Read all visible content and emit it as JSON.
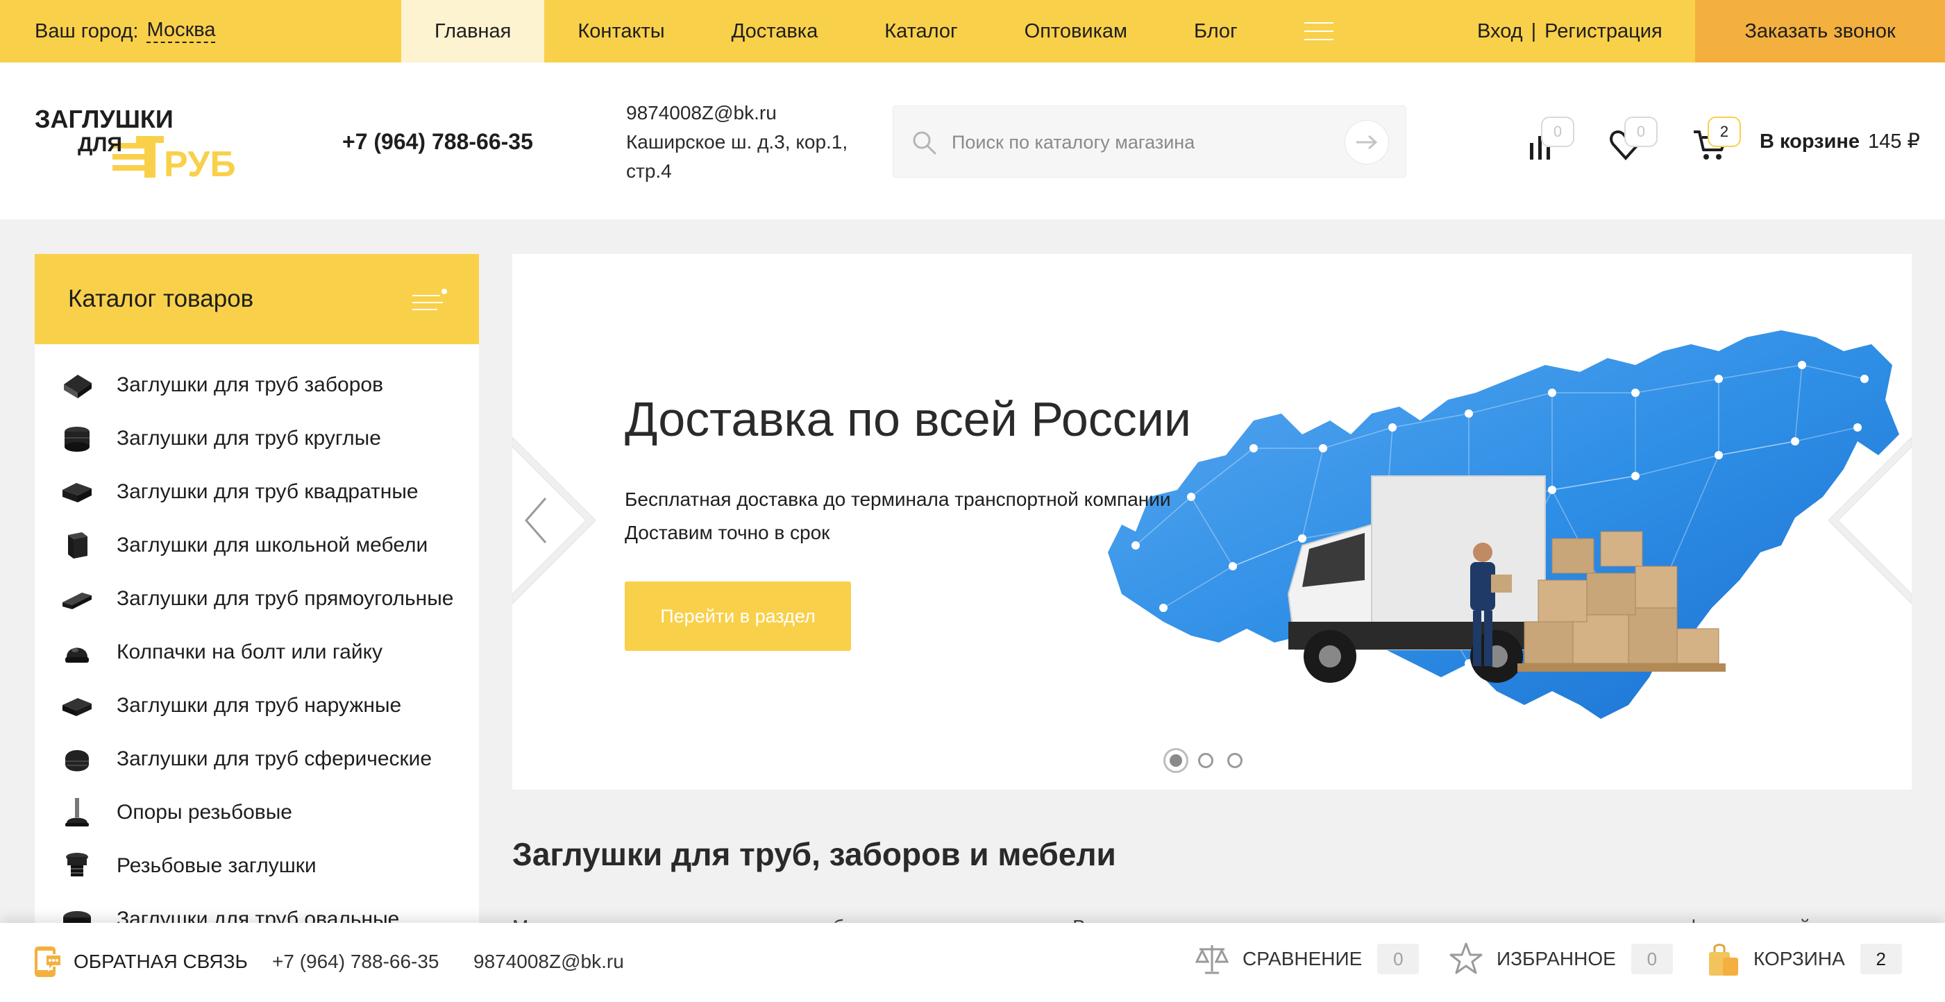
{
  "topbar": {
    "city_label": "Ваш город:",
    "city_value": "Москва",
    "nav": [
      {
        "label": "Главная"
      },
      {
        "label": "Контакты"
      },
      {
        "label": "Доставка"
      },
      {
        "label": "Каталог"
      },
      {
        "label": "Оптовикам"
      },
      {
        "label": "Блог"
      }
    ],
    "login": "Вход",
    "separator": "|",
    "register": "Регистрация",
    "callback_button": "Заказать звонок"
  },
  "header": {
    "phone": "+7 (964) 788-66-35",
    "email": "9874008Z@bk.ru",
    "address_line1": "Каширское ш. д.3, кор.1,",
    "address_line2": "стр.4",
    "search_placeholder": "Поиск по каталогу магазина",
    "compare_count": "0",
    "favorites_count": "0",
    "cart_count": "2",
    "basket_label": "В корзине",
    "basket_sum": "145 ₽"
  },
  "sidebar": {
    "title": "Каталог товаров",
    "items": [
      {
        "label": "Заглушки для труб заборов"
      },
      {
        "label": "Заглушки для труб круглые"
      },
      {
        "label": "Заглушки для труб квадратные"
      },
      {
        "label": "Заглушки для школьной мебели"
      },
      {
        "label": "Заглушки для труб прямоугольные"
      },
      {
        "label": "Колпачки на болт или гайку"
      },
      {
        "label": "Заглушки для труб наружные"
      },
      {
        "label": "Заглушки для труб сферические"
      },
      {
        "label": "Опоры резьбовые"
      },
      {
        "label": "Резьбовые заглушки"
      },
      {
        "label": "Заглушки для труб овальные"
      }
    ]
  },
  "slider": {
    "title": "Доставка по всей России",
    "text_line1": "Бесплатная доставка до терминала транспортной компании",
    "text_line2": "Доставим точно в срок",
    "button": "Перейти в раздел"
  },
  "section": {
    "title": "Заглушки для труб, заборов и мебели",
    "text": "Мы предлагаем купить заглушки собственного производства. Выполняем как розничные, так и оптовые заказы по тел. или через форму на сайте."
  },
  "bottombar": {
    "feedback": "ОБРАТНАЯ СВЯЗЬ",
    "phone": "+7 (964) 788-66-35",
    "email": "9874008Z@bk.ru",
    "compare": "СРАВНЕНИЕ",
    "compare_count": "0",
    "favorites": "ИЗБРАННОЕ",
    "favorites_count": "0",
    "cart": "КОРЗИНА",
    "cart_count": "2"
  },
  "colors": {
    "accent_yellow": "#f9d04a",
    "accent_orange": "#f3b03f",
    "map_blue": "#2f8fe6"
  }
}
